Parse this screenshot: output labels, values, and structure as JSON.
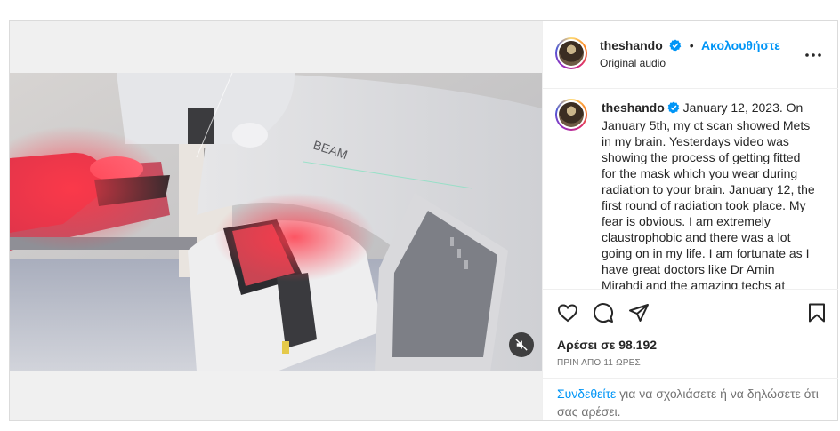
{
  "post": {
    "username": "theshando",
    "separator": "•",
    "follow_label": "Ακολουθήστε",
    "audio_label": "Original audio",
    "caption_username": "theshando",
    "caption_text": "January 12, 2023. On January 5th, my ct scan showed Mets in my brain. Yesterdays video was showing the process of getting fitted for the mask which you wear during radiation to your brain. January 12, the first round of radiation took place. My fear is obvious. I am extremely claustrophobic and there was a lot going on in my life. I am fortunate as I have great doctors like Dr Amin Mirahdi and the amazing techs at",
    "likes_label": "Αρέσει σε 98.192",
    "time_label": "ΠΡΙΝ ΑΠΟ 11 ΩΡΕΣ",
    "login_link": "Συνδεθείτε",
    "login_rest": " για να σχολιάσετε ή να δηλώσετε ότι σας αρέσει.",
    "video_brand_text": "BEAM"
  },
  "icons": {
    "verified": "verified-badge-icon",
    "more": "more-options-icon",
    "like": "heart-icon",
    "comment": "comment-icon",
    "share": "share-icon",
    "save": "bookmark-icon",
    "mute": "speaker-muted-icon"
  },
  "colors": {
    "accent": "#0095f6",
    "border": "#dbdbdb",
    "muted_text": "#737373"
  }
}
